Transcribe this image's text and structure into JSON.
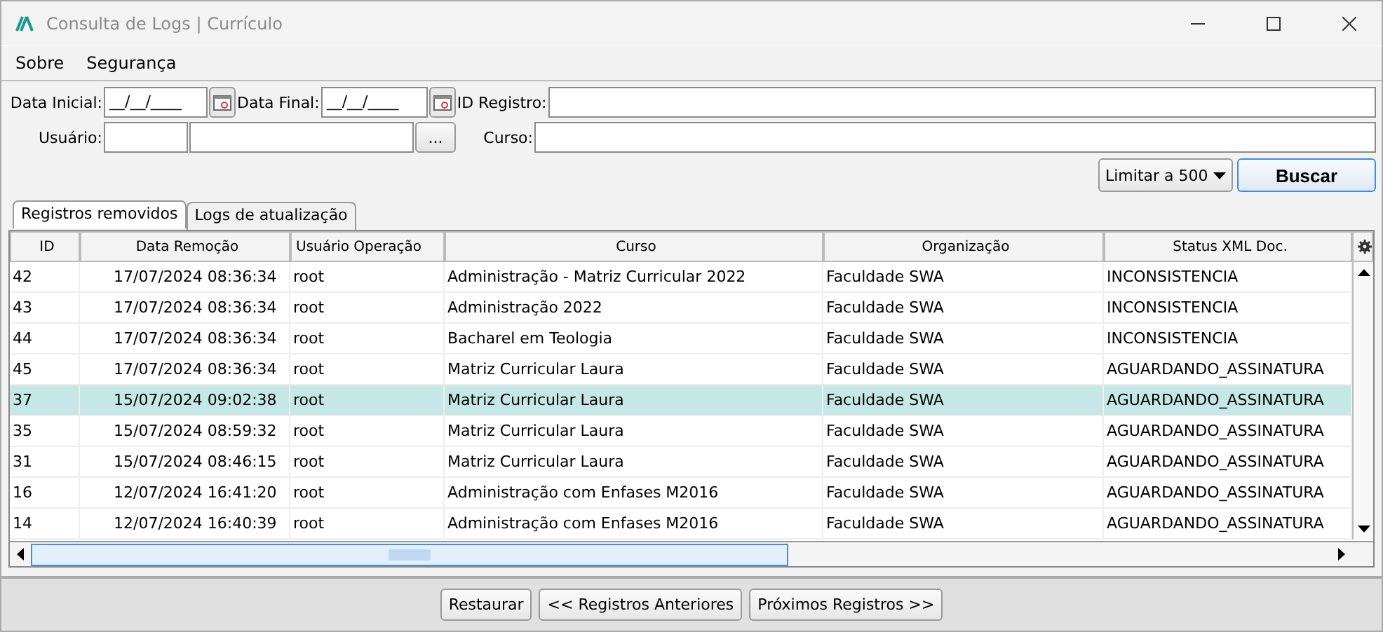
{
  "window": {
    "title": "Consulta de Logs | Currículo"
  },
  "menu": [
    "Sobre",
    "Segurança"
  ],
  "filters": {
    "data_inicial": {
      "label": "Data Inicial:",
      "value": "__/__/____"
    },
    "data_final": {
      "label": "Data Final:",
      "value": "__/__/____"
    },
    "id_registro": {
      "label": "ID Registro:"
    },
    "usuario": {
      "label": "Usuário:",
      "lookup_button": "..."
    },
    "curso": {
      "label": "Curso:"
    }
  },
  "limit": {
    "value": "Limitar a 500"
  },
  "search_button": "Buscar",
  "tabs": [
    {
      "label": "Registros removidos",
      "selected": true
    },
    {
      "label": "Logs de atualização",
      "selected": false
    }
  ],
  "table": {
    "columns": [
      "ID",
      "Data Remoção",
      "Usuário Operação",
      "Curso",
      "Organização",
      "Status XML Doc."
    ],
    "rows": [
      {
        "selected": false,
        "cells": [
          "42",
          "17/07/2024 08:36:34",
          "root",
          "Administração - Matriz Curricular 2022",
          "Faculdade SWA",
          "INCONSISTENCIA"
        ]
      },
      {
        "selected": false,
        "cells": [
          "43",
          "17/07/2024 08:36:34",
          "root",
          "Administração 2022",
          "Faculdade SWA",
          "INCONSISTENCIA"
        ]
      },
      {
        "selected": false,
        "cells": [
          "44",
          "17/07/2024 08:36:34",
          "root",
          "Bacharel em Teologia",
          "Faculdade SWA",
          "INCONSISTENCIA"
        ]
      },
      {
        "selected": false,
        "cells": [
          "45",
          "17/07/2024 08:36:34",
          "root",
          "Matriz Curricular Laura",
          "Faculdade SWA",
          "AGUARDANDO_ASSINATURA"
        ]
      },
      {
        "selected": true,
        "cells": [
          "37",
          "15/07/2024 09:02:38",
          "root",
          "Matriz Curricular Laura",
          "Faculdade SWA",
          "AGUARDANDO_ASSINATURA"
        ]
      },
      {
        "selected": false,
        "cells": [
          "35",
          "15/07/2024 08:59:32",
          "root",
          "Matriz Curricular Laura",
          "Faculdade SWA",
          "AGUARDANDO_ASSINATURA"
        ]
      },
      {
        "selected": false,
        "cells": [
          "31",
          "15/07/2024 08:46:15",
          "root",
          "Matriz Curricular Laura",
          "Faculdade SWA",
          "AGUARDANDO_ASSINATURA"
        ]
      },
      {
        "selected": false,
        "cells": [
          "16",
          "12/07/2024 16:41:20",
          "root",
          "Administração com Enfases M2016",
          "Faculdade SWA",
          "AGUARDANDO_ASSINATURA"
        ]
      },
      {
        "selected": false,
        "cells": [
          "14",
          "12/07/2024 16:40:39",
          "root",
          "Administração com Enfases M2016",
          "Faculdade SWA",
          "AGUARDANDO_ASSINATURA"
        ]
      }
    ]
  },
  "footer_buttons": [
    "Restaurar",
    "<< Registros Anteriores",
    "Próximos Registros >>"
  ]
}
